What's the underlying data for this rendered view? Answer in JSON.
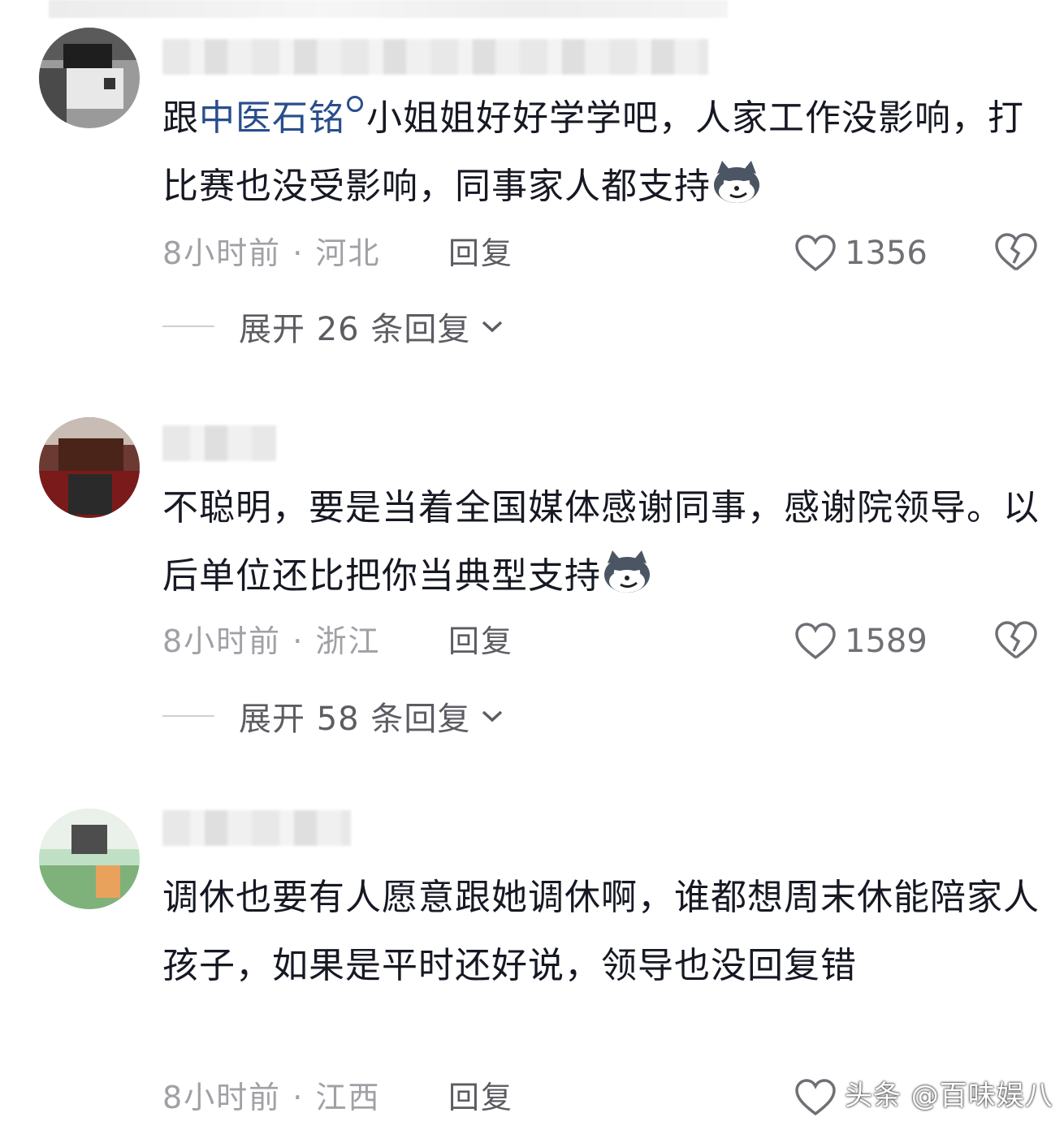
{
  "comments": [
    {
      "text_prefix": "跟",
      "mention": "中医石铭",
      "text_suffix": "小姐姐好好学学吧，人家工作没影响，打比赛也没受影响，同事家人都支持",
      "emoji_icon": "wolf-smirk-emoji",
      "time": "8小时前",
      "location": "河北",
      "reply_label": "回复",
      "likes": "1356",
      "expand_label": "展开 26 条回复"
    },
    {
      "text": "不聪明，要是当着全国媒体感谢同事，感谢院领导。以后单位还比把你当典型支持",
      "emoji_icon": "wolf-smirk-emoji",
      "time": "8小时前",
      "location": "浙江",
      "reply_label": "回复",
      "likes": "1589",
      "expand_label": "展开 58 条回复"
    },
    {
      "text": "调休也要有人愿意跟她调休啊，谁都想周末休能陪家人孩子，如果是平时还好说，领导也没回复错",
      "time": "8小时前",
      "location": "江西",
      "reply_label": "回复"
    }
  ],
  "watermark": "头条 @百味娱八",
  "colors": {
    "text": "#161823",
    "mention": "#2a4e8c",
    "meta": "#a0a0a6"
  }
}
